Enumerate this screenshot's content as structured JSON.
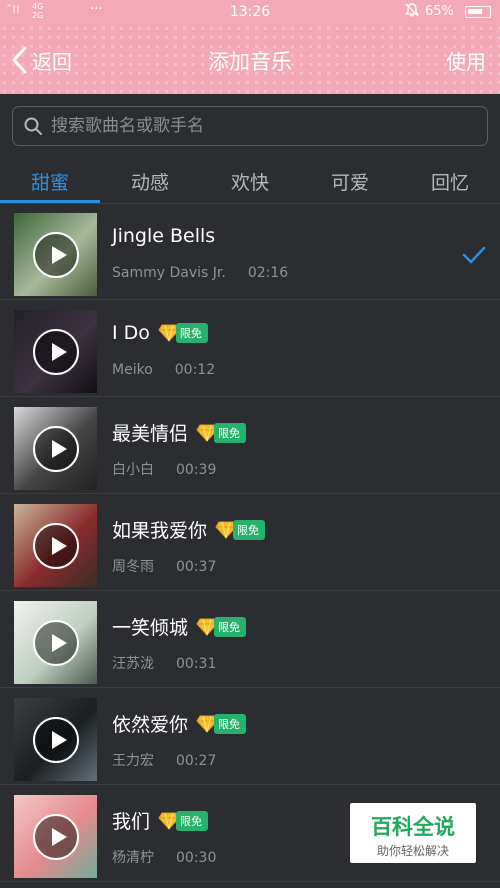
{
  "status": {
    "signal": "˝ll",
    "network_top": "4G",
    "network_bottom": "2G",
    "dots": "···",
    "time": "13:26",
    "battery_pct": "65%"
  },
  "header": {
    "back_label": "返回",
    "title": "添加音乐",
    "use_label": "使用"
  },
  "search": {
    "placeholder": "搜索歌曲名或歌手名"
  },
  "tabs": [
    "甜蜜",
    "动感",
    "欢快",
    "可爱",
    "回忆"
  ],
  "active_tab": 0,
  "songs": [
    {
      "title": "Jingle Bells",
      "artist": "Sammy Davis Jr.",
      "duration": "02:16",
      "badge": "",
      "selected": true,
      "cover_colors": [
        "#3b6a3a",
        "#a8b898",
        "#4b5d3b"
      ]
    },
    {
      "title": "I Do",
      "artist": "Meiko",
      "duration": "00:12",
      "badge": "限免",
      "selected": false,
      "cover_colors": [
        "#222028",
        "#3d3240",
        "#120f14"
      ]
    },
    {
      "title": "最美情侣",
      "artist": "白小白",
      "duration": "00:39",
      "badge": "限免",
      "selected": false,
      "cover_colors": [
        "#d9d9d9",
        "#444",
        "#222"
      ]
    },
    {
      "title": "如果我爱你",
      "artist": "周冬雨",
      "duration": "00:37",
      "badge": "限免",
      "selected": false,
      "cover_colors": [
        "#c9b59a",
        "#8a2a2a",
        "#3a2e28"
      ]
    },
    {
      "title": "一笑倾城",
      "artist": "汪苏泷",
      "duration": "00:31",
      "badge": "限免",
      "selected": false,
      "cover_colors": [
        "#f2f2f0",
        "#bfcfc0",
        "#4d5a50"
      ]
    },
    {
      "title": "依然爱你",
      "artist": "王力宏",
      "duration": "00:27",
      "badge": "限免",
      "selected": false,
      "cover_colors": [
        "#3a3f42",
        "#1c1f21",
        "#62707a"
      ]
    },
    {
      "title": "我们",
      "artist": "杨清柠",
      "duration": "00:30",
      "badge": "限免",
      "selected": false,
      "cover_colors": [
        "#f3c7c4",
        "#e48a8a",
        "#6fae9b"
      ]
    }
  ],
  "watermark": {
    "title": "百科全说",
    "subtitle": "助你轻松解决"
  },
  "colors": {
    "accent": "#2f8fdc",
    "header_pink": "#f4a9b8",
    "badge_green": "#26b26a"
  }
}
